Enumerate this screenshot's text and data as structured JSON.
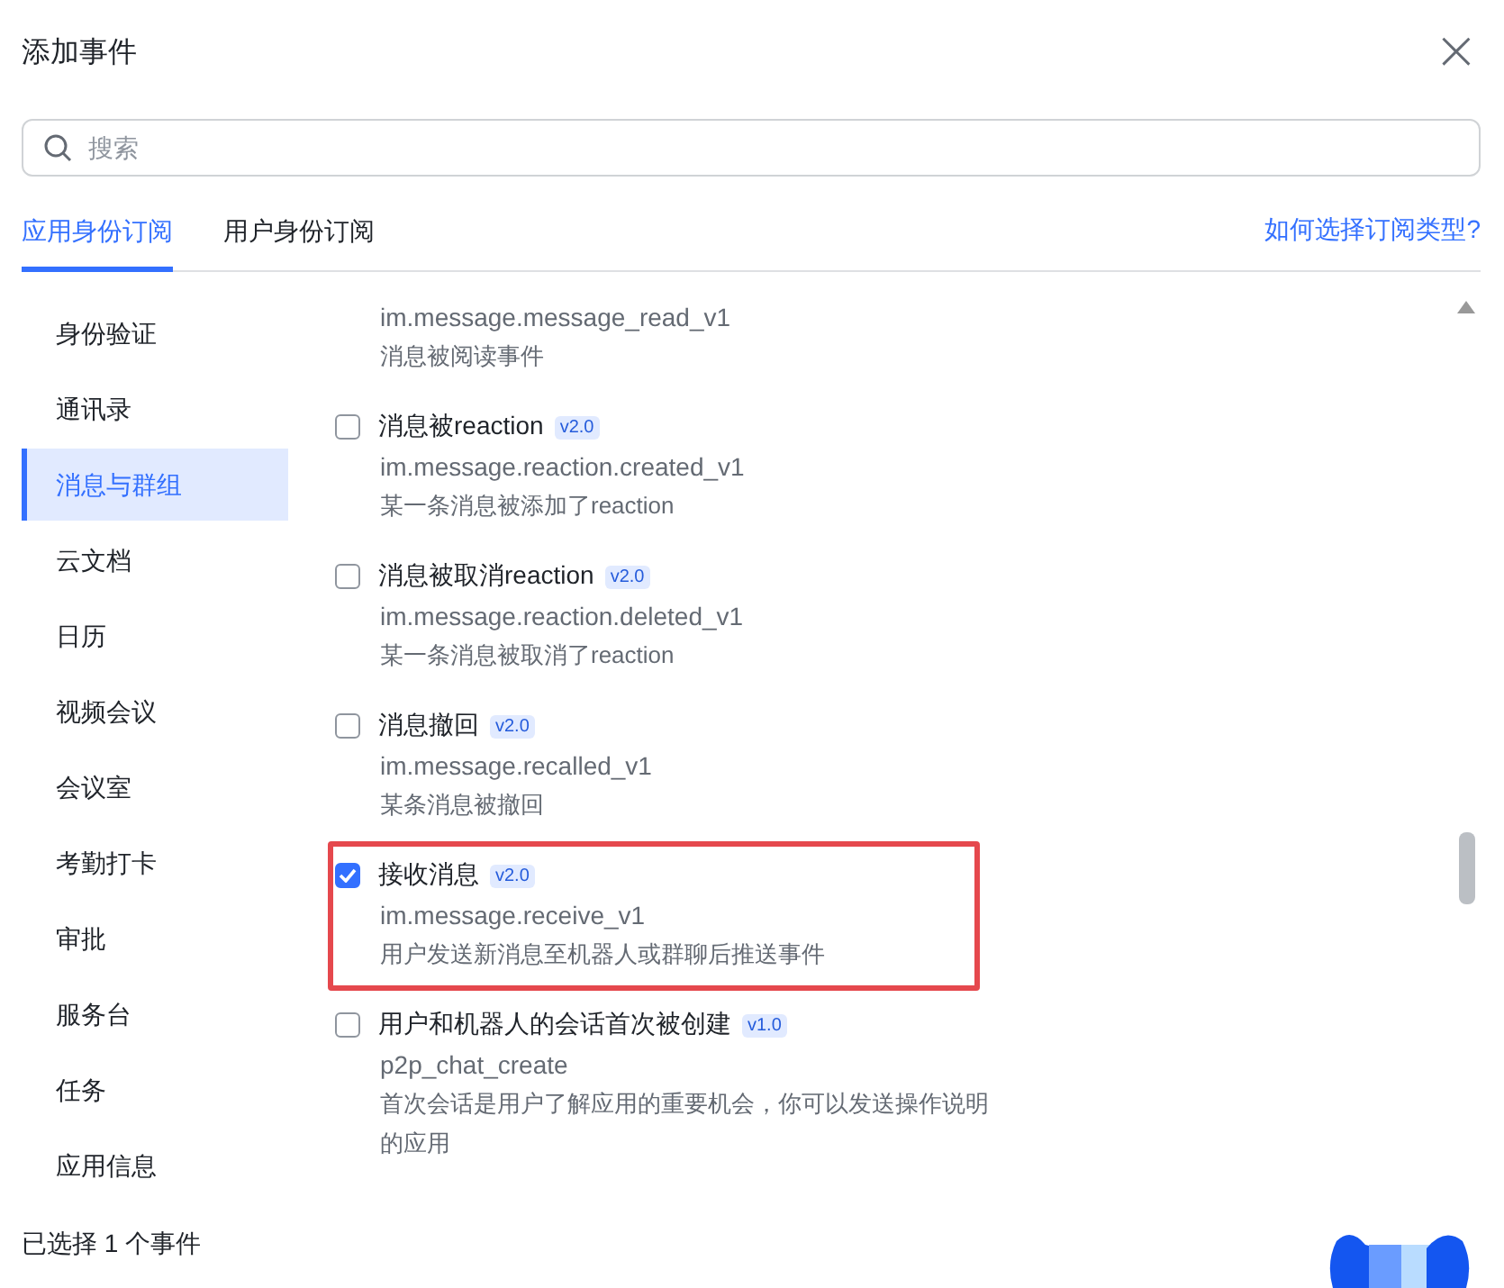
{
  "dialog": {
    "title": "添加事件",
    "close": "×"
  },
  "search": {
    "placeholder": "搜索"
  },
  "tabs": [
    {
      "label": "应用身份订阅",
      "selected": true
    },
    {
      "label": "用户身份订阅",
      "selected": false
    }
  ],
  "help_link": "如何选择订阅类型?",
  "sidebar": {
    "items": [
      {
        "label": "身份验证",
        "selected": false
      },
      {
        "label": "通讯录",
        "selected": false
      },
      {
        "label": "消息与群组",
        "selected": true
      },
      {
        "label": "云文档",
        "selected": false
      },
      {
        "label": "日历",
        "selected": false
      },
      {
        "label": "视频会议",
        "selected": false
      },
      {
        "label": "会议室",
        "selected": false
      },
      {
        "label": "考勤打卡",
        "selected": false
      },
      {
        "label": "审批",
        "selected": false
      },
      {
        "label": "服务台",
        "selected": false
      },
      {
        "label": "任务",
        "selected": false
      },
      {
        "label": "应用信息",
        "selected": false
      }
    ]
  },
  "events": [
    {
      "event": "im.message.message_read_v1",
      "description": "消息被阅读事件"
    },
    {
      "title": "消息被reaction",
      "version": "v2.0",
      "checked": false,
      "highlighted": false,
      "event": "im.message.reaction.created_v1",
      "description": "某一条消息被添加了reaction"
    },
    {
      "title": "消息被取消reaction",
      "version": "v2.0",
      "checked": false,
      "highlighted": false,
      "event": "im.message.reaction.deleted_v1",
      "description": "某一条消息被取消了reaction"
    },
    {
      "title": "消息撤回",
      "version": "v2.0",
      "checked": false,
      "highlighted": false,
      "event": "im.message.recalled_v1",
      "description": "某条消息被撤回"
    },
    {
      "title": "接收消息",
      "version": "v2.0",
      "checked": true,
      "highlighted": true,
      "event": "im.message.receive_v1",
      "description": "用户发送新消息至机器人或群聊后推送事件"
    },
    {
      "title": "用户和机器人的会话首次被创建",
      "version": "v1.0",
      "checked": false,
      "highlighted": false,
      "event": "p2p_chat_create",
      "description": "首次会话是用户了解应用的重要机会，你可以发送操作说明的应用"
    }
  ],
  "footer": {
    "selected_count": "已选择 1 个事件"
  }
}
